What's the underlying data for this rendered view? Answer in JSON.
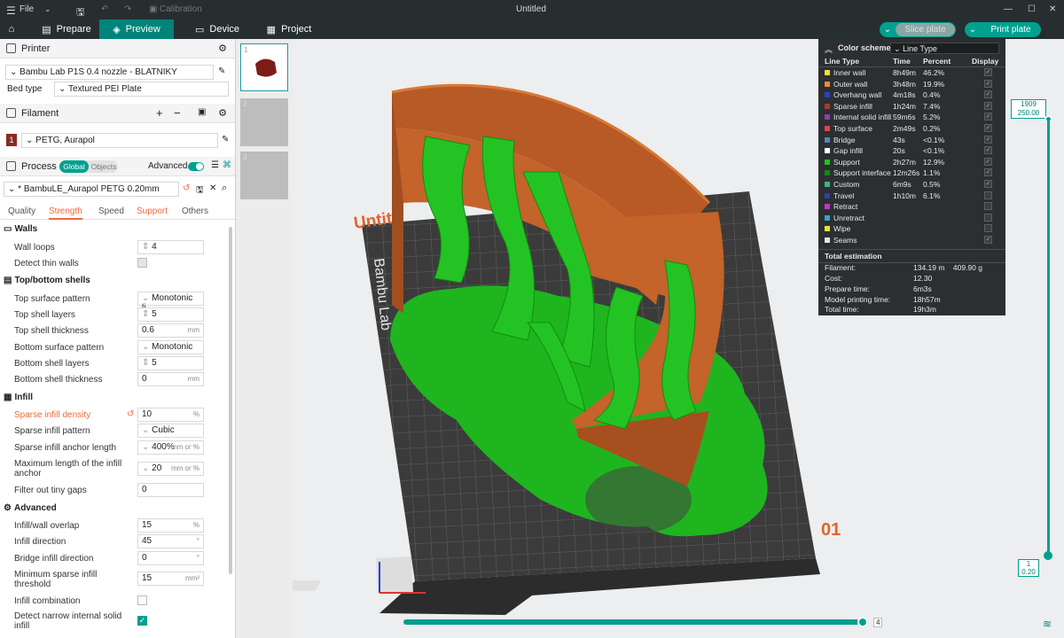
{
  "titlebar": {
    "menu": "File",
    "calibration": "Calibration",
    "title": "Untitled"
  },
  "tabs": {
    "prepare": "Prepare",
    "preview": "Preview",
    "device": "Device",
    "project": "Project",
    "slice": "Slice plate",
    "print": "Print plate"
  },
  "printer": {
    "header": "Printer",
    "name": "Bambu Lab P1S 0.4 nozzle - BLATNIKY",
    "bed_label": "Bed type",
    "bed_value": "Textured PEI Plate"
  },
  "filament": {
    "header": "Filament",
    "index": "1",
    "name": "PETG, Aurapol"
  },
  "process": {
    "header": "Process",
    "global": "Global",
    "objects": "Objects",
    "advanced": "Advanced",
    "preset": "* BambuLE_Aurapol PETG 0.20mm",
    "tabs": [
      "Quality",
      "Strength",
      "Speed",
      "Support",
      "Others"
    ]
  },
  "walls": {
    "title": "Walls",
    "wall_loops_label": "Wall loops",
    "wall_loops": "4",
    "detect_thin": "Detect thin walls"
  },
  "shells": {
    "title": "Top/bottom shells",
    "top_pattern_label": "Top surface pattern",
    "top_pattern": "Monotonic li...",
    "top_layers_label": "Top shell layers",
    "top_layers": "5",
    "top_thick_label": "Top shell thickness",
    "top_thick": "0.6",
    "bottom_pattern_label": "Bottom surface pattern",
    "bottom_pattern": "Monotonic",
    "bottom_layers_label": "Bottom shell layers",
    "bottom_layers": "5",
    "bottom_thick_label": "Bottom shell thickness",
    "bottom_thick": "0"
  },
  "infill": {
    "title": "Infill",
    "density_label": "Sparse infill density",
    "density": "10",
    "pattern_label": "Sparse infill pattern",
    "pattern": "Cubic",
    "anchor_label": "Sparse infill anchor length",
    "anchor": "400%",
    "maxlen_label": "Maximum length of the infill anchor",
    "maxlen": "20",
    "gaps_label": "Filter out tiny gaps",
    "gaps": "0"
  },
  "advanced": {
    "title": "Advanced",
    "overlap_label": "Infill/wall overlap",
    "overlap": "15",
    "dir_label": "Infill direction",
    "dir": "45",
    "bridge_label": "Bridge infill direction",
    "bridge": "0",
    "minsparse_label": "Minimum sparse infill threshold",
    "minsparse": "15",
    "combination": "Infill combination",
    "narrow": "Detect narrow internal solid infill"
  },
  "units": {
    "mm": "mm",
    "pct": "%",
    "mmpct": "mm or %",
    "deg": "°",
    "mm2": "mm²"
  },
  "thumbs": [
    "1",
    "2",
    "3"
  ],
  "legend": {
    "title": "Color scheme",
    "scheme": "Line Type",
    "col_type": "Line Type",
    "col_time": "Time",
    "col_pct": "Percent",
    "col_disp": "Display",
    "rows": [
      {
        "name": "Inner wall",
        "time": "8h49m",
        "pct": "46.2%",
        "color": "#f5d93d",
        "on": true
      },
      {
        "name": "Outer wall",
        "time": "3h48m",
        "pct": "19.9%",
        "color": "#f08a3a",
        "on": true
      },
      {
        "name": "Overhang wall",
        "time": "4m18s",
        "pct": "0.4%",
        "color": "#2340d8",
        "on": true
      },
      {
        "name": "Sparse infill",
        "time": "1h24m",
        "pct": "7.4%",
        "color": "#a63a2e",
        "on": true
      },
      {
        "name": "Internal solid infill",
        "time": "59m6s",
        "pct": "5.2%",
        "color": "#8b3fb6",
        "on": true
      },
      {
        "name": "Top surface",
        "time": "2m49s",
        "pct": "0.2%",
        "color": "#e5423a",
        "on": true
      },
      {
        "name": "Bridge",
        "time": "43s",
        "pct": "<0.1%",
        "color": "#5b84b7",
        "on": true
      },
      {
        "name": "Gap infill",
        "time": "20s",
        "pct": "<0.1%",
        "color": "#ffffff",
        "on": true
      },
      {
        "name": "Support",
        "time": "2h27m",
        "pct": "12.9%",
        "color": "#1ec21e",
        "on": true
      },
      {
        "name": "Support interface",
        "time": "12m26s",
        "pct": "1.1%",
        "color": "#128a12",
        "on": true
      },
      {
        "name": "Custom",
        "time": "6m9s",
        "pct": "0.5%",
        "color": "#3db57a",
        "on": true
      },
      {
        "name": "Travel",
        "time": "1h10m",
        "pct": "6.1%",
        "color": "#3140a8",
        "on": false
      },
      {
        "name": "Retract",
        "time": "",
        "pct": "",
        "color": "#c832c8",
        "on": false
      },
      {
        "name": "Unretract",
        "time": "",
        "pct": "",
        "color": "#2fa7c9",
        "on": false
      },
      {
        "name": "Wipe",
        "time": "",
        "pct": "",
        "color": "#f2e02e",
        "on": false
      },
      {
        "name": "Seams",
        "time": "",
        "pct": "",
        "color": "#e6e6e6",
        "on": true
      }
    ],
    "total_title": "Total estimation",
    "filament_label": "Filament:",
    "filament": "134.19 m    409.90 g",
    "cost_label": "Cost:",
    "cost": "12.30",
    "prep_label": "Prepare time:",
    "prep": "6m3s",
    "model_label": "Model printing time:",
    "model": "18h57m",
    "total_label": "Total time:",
    "total": "19h3m"
  },
  "vslider": {
    "top_layer": "1909",
    "top_height": "250.00",
    "bottom_layer": "1",
    "bottom_height": "0.20"
  },
  "hslider": {
    "value": "4"
  },
  "scene": {
    "bed_brand": "Bambu Lab",
    "plate_num": "01",
    "plate_name": "Untitl"
  }
}
